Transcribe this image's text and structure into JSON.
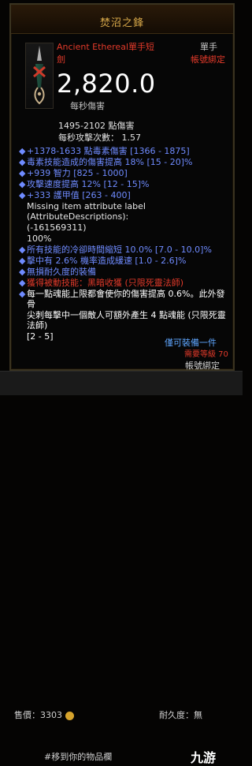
{
  "header": {
    "title": "焚沼之鋒"
  },
  "item": {
    "type_line1": "Ancient Ethereal單手短",
    "type_line2": "劍",
    "slot": "單手",
    "account_bound": "帳號綁定",
    "dps_value": "2,820.0",
    "dps_label": "每秒傷害",
    "damage_line": "1495-2102 點傷害",
    "speed_line": "每秒攻擊次數： 1.57"
  },
  "stats": [
    {
      "bullet": "◆",
      "text": "+1378-1633 點毒素傷害 [1366 - 1875]",
      "style": "blue"
    },
    {
      "bullet": "◆",
      "text": "毒素技能造成的傷害提高 18% [15 - 20]%",
      "style": "blue"
    },
    {
      "bullet": "◆",
      "text": "+939 智力 [825 - 1000]",
      "style": "blue"
    },
    {
      "bullet": "◆",
      "text": "攻擊速度提高 12% [12 - 15]%",
      "style": "blue"
    },
    {
      "bullet": "◆",
      "text": "+333 護甲值 [263 - 400]",
      "style": "blue"
    },
    {
      "bullet": "",
      "text": "Missing item attribute label (AttributeDescriptions):",
      "style": "white"
    },
    {
      "bullet": "",
      "text": "(-161569311)",
      "style": "white"
    },
    {
      "bullet": "",
      "text": "100%",
      "style": "white"
    },
    {
      "bullet": "◆",
      "text": "所有技能的冷卻時間縮短 10.0% [7.0 - 10.0]%",
      "style": "blue"
    },
    {
      "bullet": "◆",
      "text": "擊中有 2.6% 機率造成緩速 [1.0 - 2.6]%",
      "style": "blue"
    },
    {
      "bullet": "◆",
      "text": "無損耐久度的裝備",
      "style": "blue"
    },
    {
      "bullet": "◆",
      "text": "獲得被動技能：黑暗收獲 (只限死靈法師)",
      "style": "red"
    },
    {
      "bullet": "◆",
      "text": "每一點魂能上限都會使你的傷害提高 0.6%。此外發骨",
      "style": "redmix",
      "redtail": ""
    },
    {
      "bullet": "",
      "text": "尖刺每擊中一個敵人可額外產生 4 點魂能 (只限死靈法師)",
      "style": "redmix",
      "redtail": ""
    },
    {
      "bullet": "",
      "text": "[2 - 5]",
      "style": "redmix",
      "redtail": ""
    }
  ],
  "footer": {
    "can_buy": "僅可裝備一件",
    "required": "需要等級 70",
    "bound": "帳號綁定",
    "price": "售價：3303",
    "durability": "耐久度：無"
  },
  "bottom_hint": "#移到你的物品欄",
  "watermark": "九游"
}
